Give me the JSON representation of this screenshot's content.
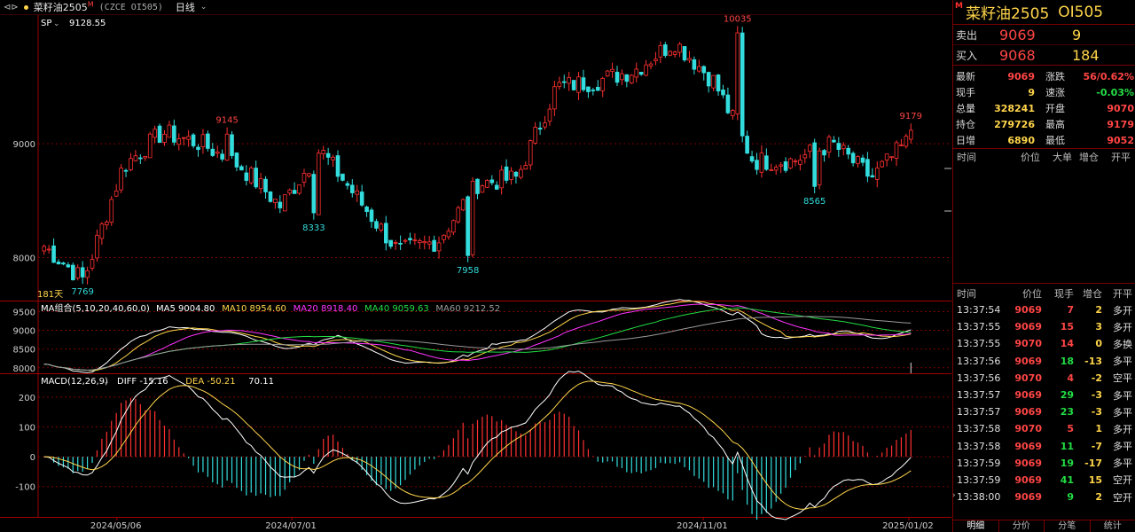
{
  "topbar": {
    "nav_icon": "⊲⊳",
    "instrument_name": "菜籽油2505",
    "instrument_badge": "M",
    "instrument_code": "(CZCE OI505)",
    "period": "日线"
  },
  "chart_panels": {
    "main": {
      "label": "SP",
      "label_value": "9128.55",
      "ylabels": [
        "9000",
        "8000"
      ],
      "annotations": [
        {
          "text": "7769",
          "color": "#33dddd"
        },
        {
          "text": "9145",
          "color": "#ff4545"
        },
        {
          "text": "8333",
          "color": "#33dddd"
        },
        {
          "text": "7958",
          "color": "#33dddd"
        },
        {
          "text": "10035",
          "color": "#ff4545"
        },
        {
          "text": "8565",
          "color": "#33dddd"
        },
        {
          "text": "9179",
          "color": "#ff4545"
        }
      ],
      "bars_label": "181天"
    },
    "ma": {
      "title": "MA组合(5,10,20,40,60,0)",
      "items": [
        {
          "label": "MA5 9004.80",
          "color": "#ffffff"
        },
        {
          "label": "MA10 8954.60",
          "color": "#ffd54a"
        },
        {
          "label": "MA20 8918.40",
          "color": "#ff33ff"
        },
        {
          "label": "MA40 9059.63",
          "color": "#22dd44"
        },
        {
          "label": "MA60 9212.52",
          "color": "#9a9a9a"
        }
      ],
      "ylabels": [
        "9500",
        "9000",
        "8500",
        "8000"
      ]
    },
    "macd": {
      "title": "MACD(12,26,9)",
      "items": [
        {
          "label": "DIFF -15.16",
          "color": "#ffffff"
        },
        {
          "label": "DEA -50.21",
          "color": "#ffd54a"
        },
        {
          "label": "70.11",
          "color": "#ffffff"
        }
      ],
      "ylabels": [
        "200",
        "100",
        "0",
        "-100"
      ]
    },
    "xaxis": [
      "2024/05/06",
      "2024/07/01",
      "2024/11/01",
      "2025/01/02"
    ]
  },
  "chart_data": [
    {
      "type": "candlestick",
      "title": "",
      "bars": 181,
      "ylim": [
        7700,
        10100
      ],
      "key_points": [
        {
          "bar": 8,
          "value": 7769,
          "kind": "low"
        },
        {
          "bar": 38,
          "value": 9145,
          "kind": "high"
        },
        {
          "bar": 56,
          "value": 8333,
          "kind": "low"
        },
        {
          "bar": 88,
          "value": 7958,
          "kind": "low"
        },
        {
          "bar": 144,
          "value": 10035,
          "kind": "high"
        },
        {
          "bar": 160,
          "value": 8565,
          "kind": "low"
        },
        {
          "bar": 180,
          "value": 9179,
          "kind": "high"
        }
      ],
      "close_path": [
        8100,
        7800,
        8800,
        9100,
        9000,
        8800,
        8450,
        8950,
        8500,
        8050,
        8150,
        8650,
        8700,
        9500,
        9550,
        9650,
        9900,
        9550,
        8850,
        8850,
        9000,
        8700,
        9050
      ]
    },
    {
      "type": "line",
      "title": "MA组合(5,10,20,40,60,0)",
      "series": [
        {
          "name": "MA5",
          "last": 9004.8
        },
        {
          "name": "MA10",
          "last": 8954.6
        },
        {
          "name": "MA20",
          "last": 8918.4
        },
        {
          "name": "MA40",
          "last": 9059.63
        },
        {
          "name": "MA60",
          "last": 9212.52
        }
      ],
      "ylim": [
        7900,
        9700
      ]
    },
    {
      "type": "bar",
      "title": "MACD(12,26,9)",
      "series": [
        {
          "name": "DIFF",
          "last": -15.16
        },
        {
          "name": "DEA",
          "last": -50.21
        },
        {
          "name": "MACD",
          "last": 70.11
        }
      ],
      "ylim": [
        -190,
        250
      ]
    }
  ],
  "quote": {
    "title": "菜籽油2505",
    "code": "OI505",
    "badge": "M",
    "sell": {
      "label": "卖出",
      "price": "9069",
      "volume": "9"
    },
    "buy": {
      "label": "买入",
      "price": "9068",
      "volume": "184"
    },
    "stats": [
      {
        "k": "最新",
        "v": "9069",
        "vc": "red",
        "k2": "涨跌",
        "v2": "56/0.62%",
        "v2c": "red"
      },
      {
        "k": "现手",
        "v": "9",
        "vc": "yel",
        "k2": "速涨",
        "v2": "-0.03%",
        "v2c": "grn"
      },
      {
        "k": "总量",
        "v": "328241",
        "vc": "yel",
        "k2": "开盘",
        "v2": "9070",
        "v2c": "red"
      },
      {
        "k": "持仓",
        "v": "279726",
        "vc": "yel",
        "k2": "最高",
        "v2": "9179",
        "v2c": "red"
      },
      {
        "k": "日增",
        "v": "6890",
        "vc": "yel",
        "k2": "最低",
        "v2": "9052",
        "v2c": "red"
      }
    ]
  },
  "big_orders": {
    "headers": [
      "时间",
      "价位",
      "大单",
      "增仓",
      "开平"
    ]
  },
  "ticks": {
    "headers": [
      "时间",
      "价位",
      "现手",
      "增仓",
      "开平"
    ],
    "rows": [
      {
        "t": "13:37:54",
        "p": "9069",
        "pc": "red",
        "q": "7",
        "qc": "red",
        "c": "2",
        "n": "多开"
      },
      {
        "t": "13:37:55",
        "p": "9069",
        "pc": "red",
        "q": "15",
        "qc": "red",
        "c": "3",
        "n": "多开"
      },
      {
        "t": "13:37:55",
        "p": "9070",
        "pc": "red",
        "q": "14",
        "qc": "red",
        "c": "0",
        "n": "多换"
      },
      {
        "t": "13:37:56",
        "p": "9069",
        "pc": "red",
        "q": "18",
        "qc": "grn",
        "c": "-13",
        "n": "多平"
      },
      {
        "t": "13:37:56",
        "p": "9070",
        "pc": "red",
        "q": "4",
        "qc": "red",
        "c": "-2",
        "n": "空平"
      },
      {
        "t": "13:37:57",
        "p": "9069",
        "pc": "red",
        "q": "29",
        "qc": "grn",
        "c": "-3",
        "n": "多平"
      },
      {
        "t": "13:37:57",
        "p": "9069",
        "pc": "red",
        "q": "23",
        "qc": "grn",
        "c": "-3",
        "n": "多平"
      },
      {
        "t": "13:37:58",
        "p": "9070",
        "pc": "red",
        "q": "5",
        "qc": "red",
        "c": "1",
        "n": "多开"
      },
      {
        "t": "13:37:58",
        "p": "9069",
        "pc": "red",
        "q": "11",
        "qc": "grn",
        "c": "-7",
        "n": "多平"
      },
      {
        "t": "13:37:59",
        "p": "9069",
        "pc": "red",
        "q": "19",
        "qc": "grn",
        "c": "-17",
        "n": "多平"
      },
      {
        "t": "13:37:59",
        "p": "9069",
        "pc": "red",
        "q": "41",
        "qc": "grn",
        "c": "15",
        "n": "空开"
      },
      {
        "t": "13:38:00",
        "p": "9069",
        "pc": "red",
        "q": "9",
        "qc": "grn",
        "c": "2",
        "n": "空开"
      }
    ],
    "current_marker": "›"
  },
  "tabs": [
    "明细",
    "分价",
    "分笔",
    "统计"
  ]
}
